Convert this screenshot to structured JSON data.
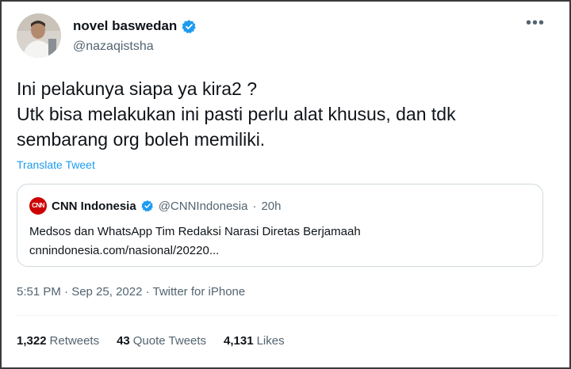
{
  "tweet": {
    "author": {
      "display_name": "novel baswedan",
      "handle": "@nazaqistsha",
      "verified_icon": "verified-badge-icon"
    },
    "more_icon": "more-options-icon",
    "text_lines": [
      "Ini pelakunya siapa ya kira2 ?",
      "Utk bisa melakukan ini pasti perlu alat khusus, dan tdk",
      "sembarang org boleh memiliki."
    ],
    "translate_label": "Translate Tweet",
    "quote": {
      "logo_text": "CNN",
      "display_name": "CNN Indonesia",
      "handle": "@CNNIndonesia",
      "separator": "·",
      "time": "20h",
      "text": "Medsos dan WhatsApp Tim Redaksi Narasi Diretas Berjamaah",
      "link": "cnnindonesia.com/nasional/20220..."
    },
    "meta": "5:51 PM · Sep 25, 2022 · Twitter for iPhone",
    "stats": {
      "retweets_count": "1,322",
      "retweets_label": "Retweets",
      "quotes_count": "43",
      "quotes_label": "Quote Tweets",
      "likes_count": "4,131",
      "likes_label": "Likes"
    }
  },
  "colors": {
    "accent": "#1d9bf0",
    "text_primary": "#0f1419",
    "text_secondary": "#536471",
    "border": "#cfd9de",
    "cnn_red": "#cc0000"
  }
}
